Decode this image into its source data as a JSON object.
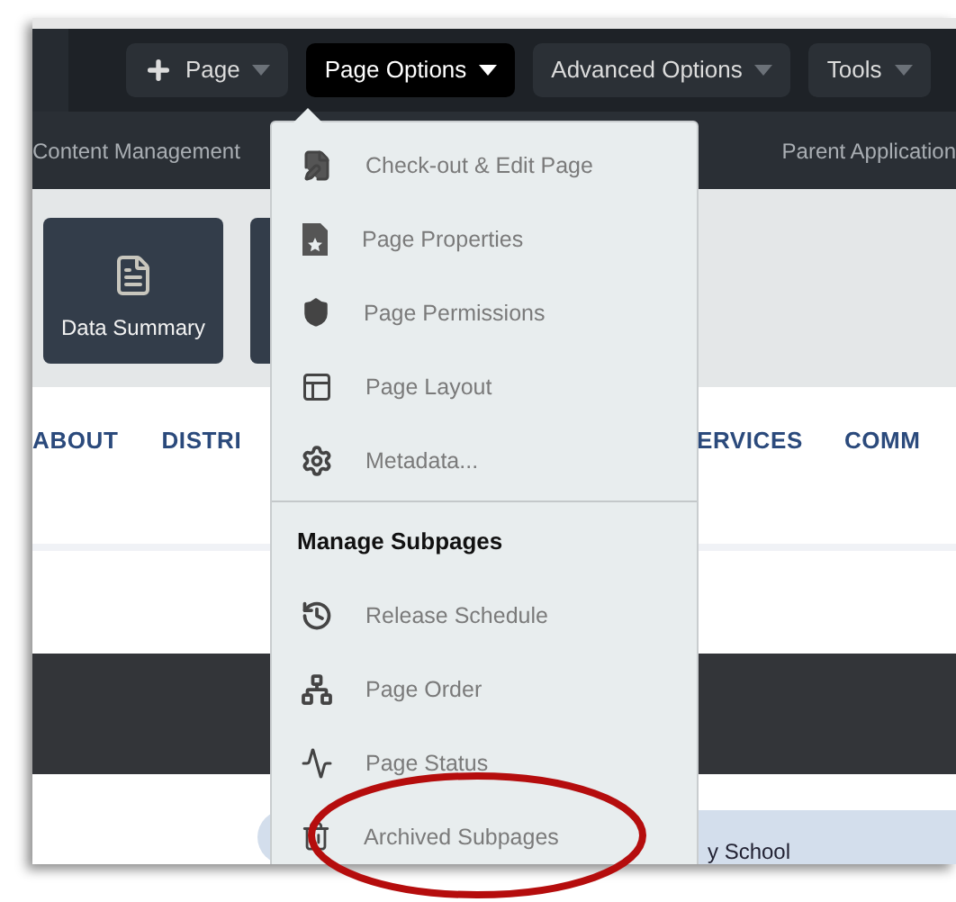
{
  "toolbar": {
    "buttons": [
      {
        "label": "Page",
        "selected": false
      },
      {
        "label": "Page Options",
        "selected": true
      },
      {
        "label": "Advanced Options",
        "selected": false
      },
      {
        "label": "Tools",
        "selected": false
      }
    ]
  },
  "subnav": [
    "Content Management",
    "Parent Application"
  ],
  "tiles": [
    "Data Summary"
  ],
  "nav": [
    "ABOUT",
    "DISTRI",
    "ERVICES",
    "COMM"
  ],
  "banner_text": "y School",
  "menu": {
    "items": [
      {
        "kind": "item",
        "label": "Check-out & Edit Page"
      },
      {
        "kind": "item",
        "label": "Page Properties"
      },
      {
        "kind": "item",
        "label": "Page Permissions"
      },
      {
        "kind": "item",
        "label": "Page Layout"
      },
      {
        "kind": "item",
        "label": "Metadata..."
      },
      {
        "kind": "header",
        "label": "Manage Subpages"
      },
      {
        "kind": "item",
        "label": "Release Schedule"
      },
      {
        "kind": "item",
        "label": "Page Order"
      },
      {
        "kind": "item",
        "label": "Page Status"
      },
      {
        "kind": "item",
        "label": "Archived Subpages"
      }
    ]
  }
}
